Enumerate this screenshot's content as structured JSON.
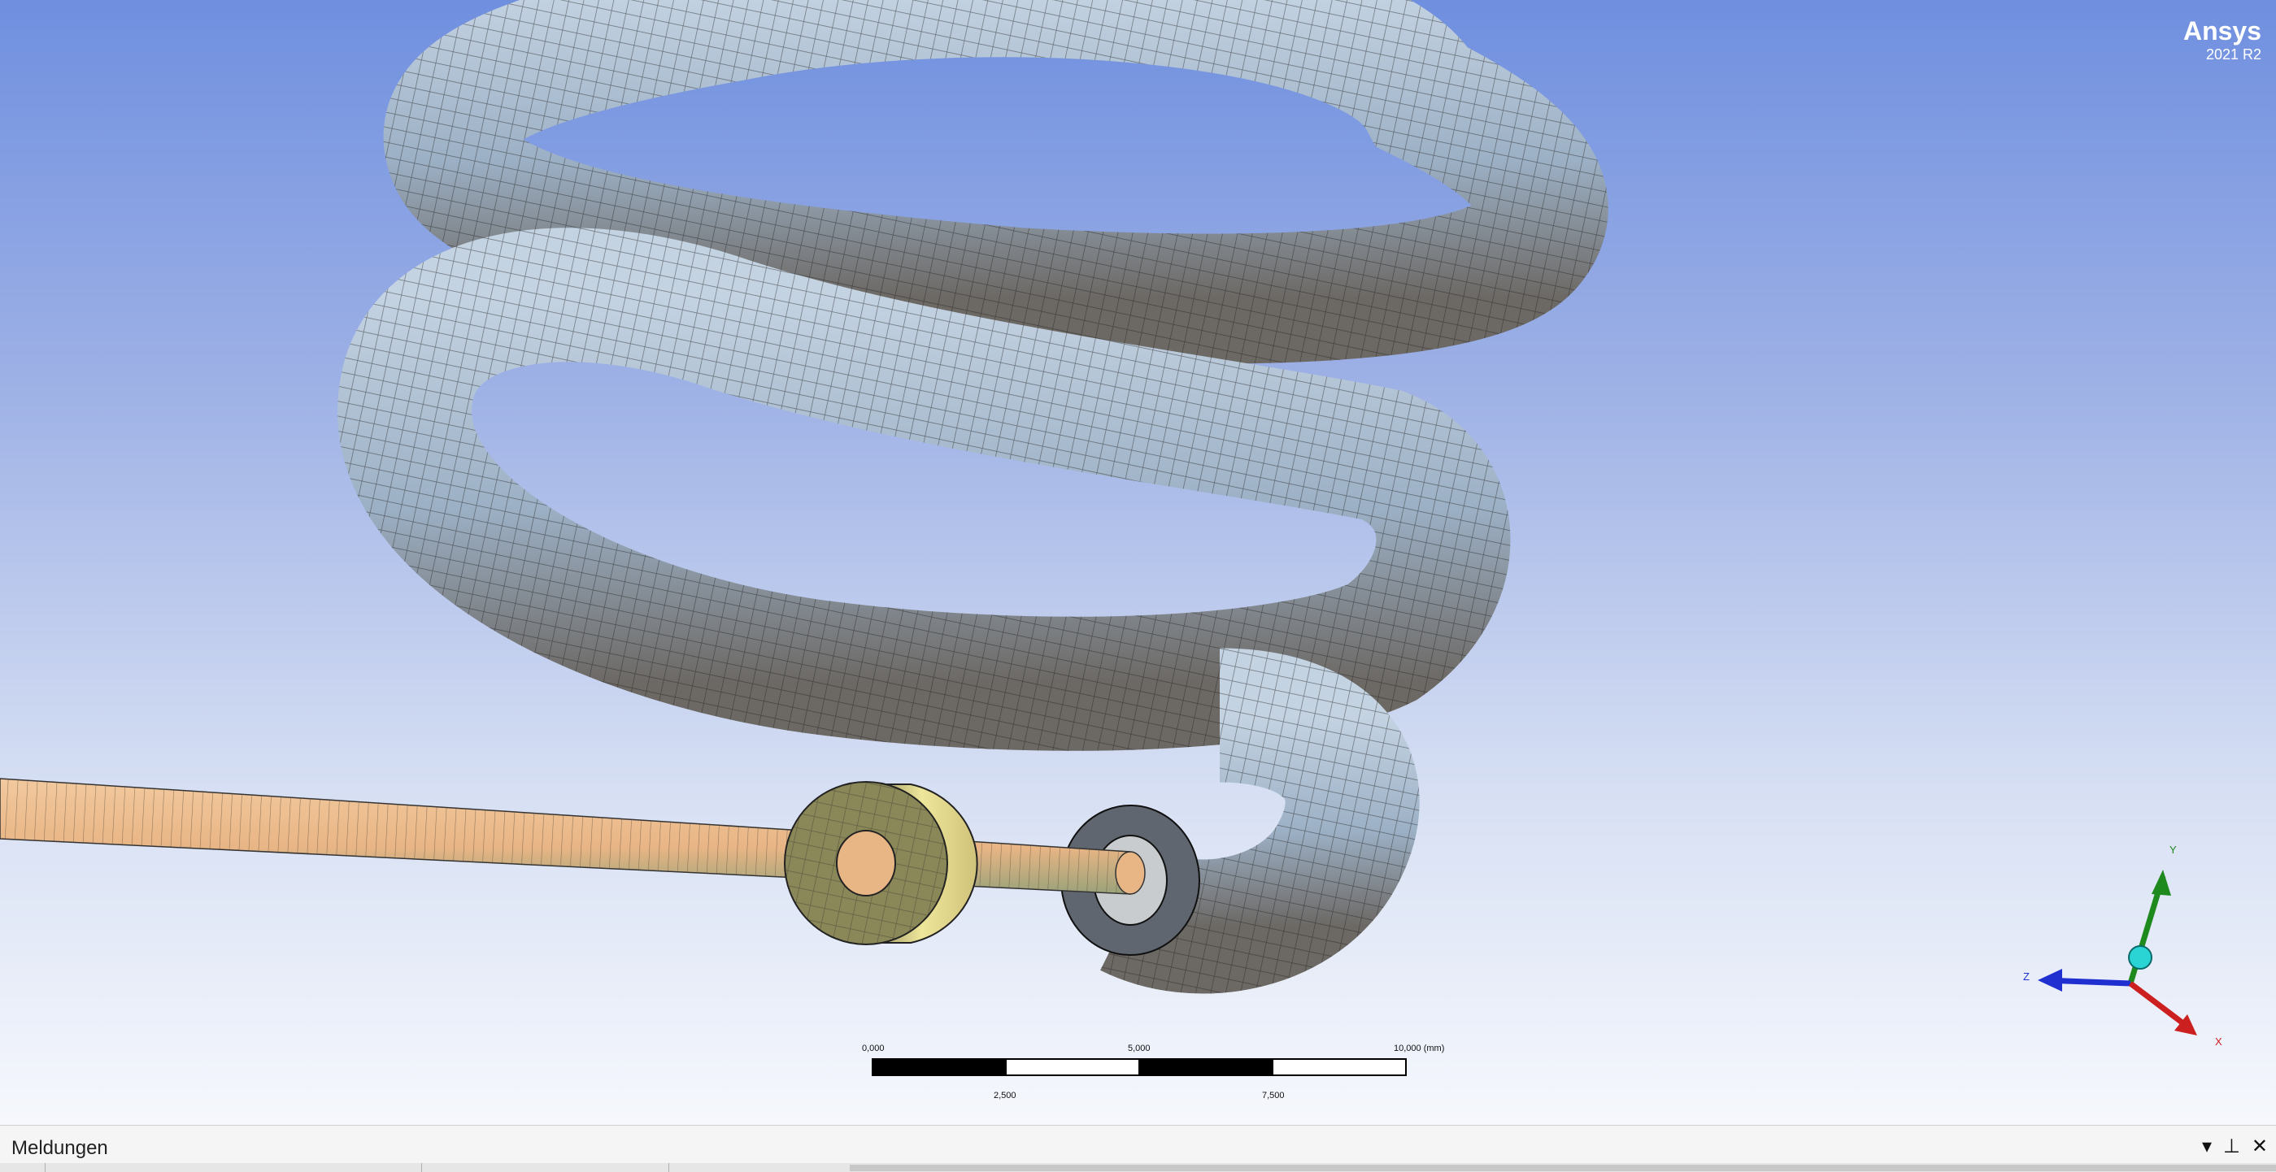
{
  "app": {
    "brand": "Ansys",
    "version": "2021 R2"
  },
  "scale": {
    "ticks_top": [
      "0,000",
      "5,000",
      "10,000 (mm)"
    ],
    "ticks_bottom": [
      "2,500",
      "7,500"
    ]
  },
  "axes": {
    "x": "X",
    "y": "Y",
    "z": "Z"
  },
  "panel": {
    "title": "Meldungen"
  },
  "colors": {
    "coil": "#9eb3c8",
    "rod": "#e9b98d",
    "ring": "#e6df8e",
    "mesh": "#222222",
    "x_axis": "#cc1f1f",
    "y_axis": "#1e8a1e",
    "z_axis": "#1f2fd0"
  },
  "icons": [
    "dropdown-icon",
    "pin-icon",
    "close-icon"
  ]
}
